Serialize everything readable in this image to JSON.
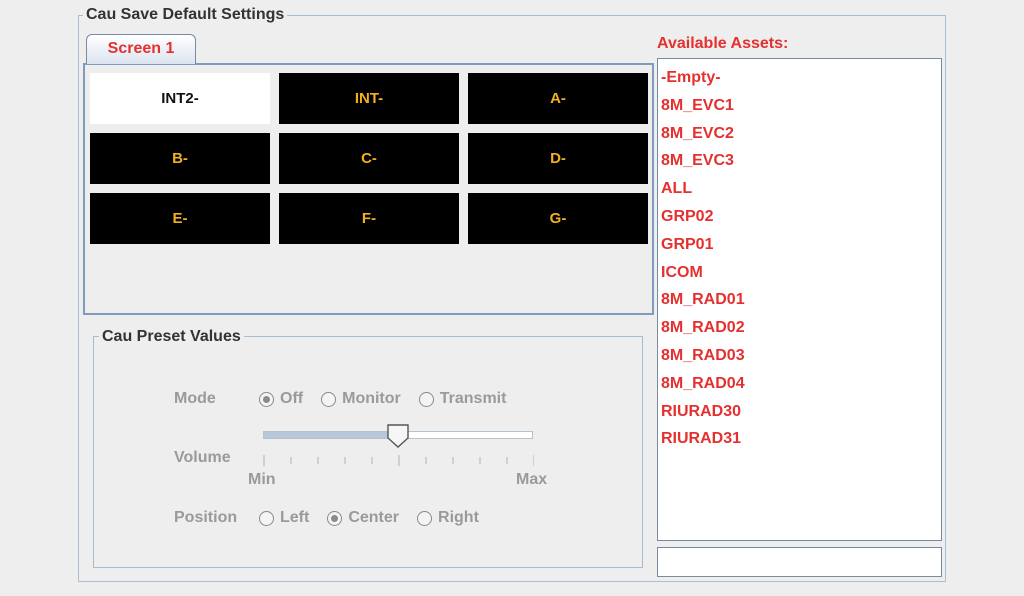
{
  "settings_title": "Cau Save Default Settings",
  "tab": {
    "label": "Screen 1"
  },
  "grid_cells": [
    "INT2-",
    "INT-",
    "A-",
    "B-",
    "C-",
    "D-",
    "E-",
    "F-",
    "G-"
  ],
  "selected_cell_index": 0,
  "preset": {
    "title": "Cau Preset Values",
    "mode": {
      "label": "Mode",
      "options": [
        "Off",
        "Monitor",
        "Transmit"
      ],
      "selected": "Off"
    },
    "volume": {
      "label": "Volume",
      "min_label": "Min",
      "max_label": "Max",
      "value_fraction": 0.5
    },
    "position": {
      "label": "Position",
      "options": [
        "Left",
        "Center",
        "Right"
      ],
      "selected": "Center"
    }
  },
  "assets": {
    "title": "Available Assets:",
    "items": [
      "-Empty-",
      "8M_EVC1",
      "8M_EVC2",
      "8M_EVC3",
      "ALL",
      "GRP02",
      "GRP01",
      "ICOM",
      "8M_RAD01",
      "8M_RAD02",
      "8M_RAD03",
      "8M_RAD04",
      "RIURAD30",
      "RIURAD31"
    ],
    "input_value": ""
  },
  "colors": {
    "accent_red": "#e53030",
    "cell_text": "#f0b020",
    "cell_bg": "#000000",
    "disabled_text": "#9a9a9a"
  }
}
